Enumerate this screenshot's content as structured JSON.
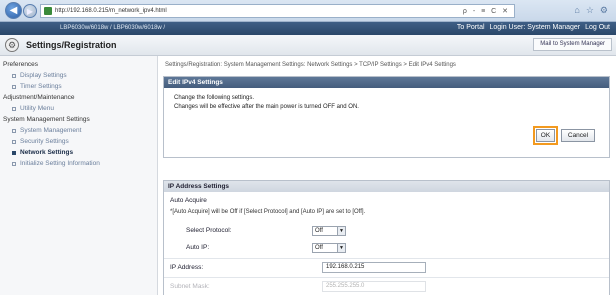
{
  "browser": {
    "url": "http://192.168.0.215/m_network_ipv4.html",
    "tools": "ρ - ≡ C ✕",
    "icons": [
      "home-icon",
      "star-icon",
      "gear-icon"
    ]
  },
  "device_bar": {
    "model": "LBP6030w/6018w / LBP6030w/6018w /",
    "to_portal": "To Portal",
    "login_user": "Login User: System Manager",
    "log_out": "Log Out"
  },
  "header": {
    "title": "Settings/Registration",
    "mail_link": "Mail to System Manager"
  },
  "sidebar": {
    "sections": [
      {
        "label": "Preferences",
        "items": [
          "Display Settings",
          "Timer Settings"
        ]
      },
      {
        "label": "Adjustment/Maintenance",
        "items": [
          "Utility Menu"
        ]
      },
      {
        "label": "System Management Settings",
        "items": [
          "System Management",
          "Security Settings",
          "Network Settings",
          "Initialize Setting Information"
        ]
      }
    ],
    "active_item": "Network Settings"
  },
  "main": {
    "breadcrumb": "Settings/Registration: System Management Settings: Network Settings > TCP/IP Settings > Edit IPv4 Settings",
    "edit_panel": {
      "title": "Edit IPv4 Settings",
      "message_1": "Change the following settings.",
      "message_2": "Changes will be effective after the main power is turned OFF and ON.",
      "ok_label": "OK",
      "cancel_label": "Cancel"
    },
    "ip_panel": {
      "title": "IP Address Settings",
      "auto_acquire_label": "Auto Acquire",
      "note": "*[Auto Acquire] will be Off if [Select Protocol] and [Auto IP] are set to [Off].",
      "select_protocol_label": "Select Protocol:",
      "select_protocol_value": "Off",
      "auto_ip_label": "Auto IP:",
      "auto_ip_value": "Off",
      "ip_address_label": "IP Address:",
      "ip_address_value": "192.168.0.215",
      "subnet_mask_label": "Subnet Mask:",
      "subnet_mask_value": "255.255.255.0"
    }
  },
  "colors": {
    "accent_orange": "#f39a1f",
    "devbar_blue": "#2a4769",
    "panel_head": "#455d7d"
  }
}
